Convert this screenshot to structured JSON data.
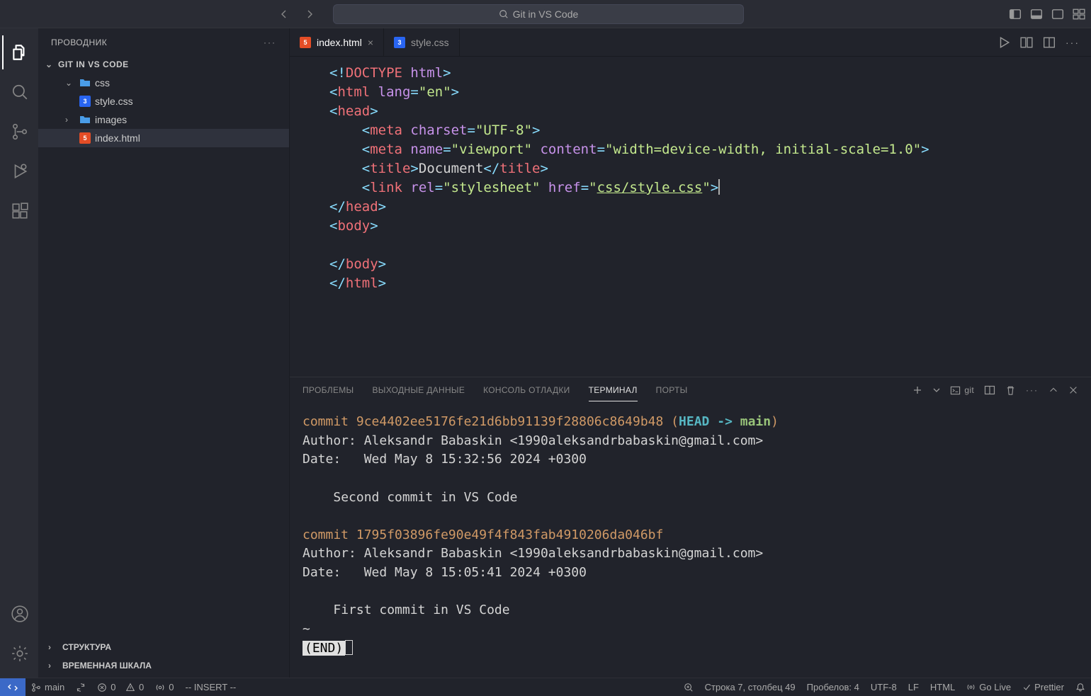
{
  "titlebar": {
    "search_text": "Git in VS Code"
  },
  "sidebar": {
    "title": "ПРОВОДНИК",
    "project": "GIT IN VS CODE",
    "folders": {
      "css": "css",
      "stylecss": "style.css",
      "images": "images",
      "indexhtml": "index.html"
    },
    "structure": "СТРУКТУРА",
    "timeline": "ВРЕМЕННАЯ ШКАЛА"
  },
  "tabs": {
    "index": "index.html",
    "style": "style.css"
  },
  "editor": {
    "l1a": "<!",
    "l1b": "DOCTYPE ",
    "l1c": "html",
    "l1d": ">",
    "l2a": "<",
    "l2b": "html ",
    "l2c": "lang",
    "l2d": "=",
    "l2e": "\"en\"",
    "l2f": ">",
    "l3a": "<",
    "l3b": "head",
    "l3c": ">",
    "l4a": "<",
    "l4b": "meta ",
    "l4c": "charset",
    "l4d": "=",
    "l4e": "\"UTF-8\"",
    "l4f": ">",
    "l5a": "<",
    "l5b": "meta ",
    "l5c": "name",
    "l5d": "=",
    "l5e": "\"viewport\" ",
    "l5f": "content",
    "l5g": "=",
    "l5h": "\"width=device-width, initial-scale=1.0\"",
    "l5i": ">",
    "l6a": "<",
    "l6b": "title",
    "l6c": ">",
    "l6d": "Document",
    "l6e": "</",
    "l6f": "title",
    "l6g": ">",
    "l7a": "<",
    "l7b": "link ",
    "l7c": "rel",
    "l7d": "=",
    "l7e": "\"stylesheet\" ",
    "l7f": "href",
    "l7g": "=",
    "l7h": "\"",
    "l7i": "css/style.css",
    "l7j": "\"",
    "l7k": ">",
    "l8a": "</",
    "l8b": "head",
    "l8c": ">",
    "l9a": "<",
    "l9b": "body",
    "l9c": ">",
    "l10": "",
    "l11a": "</",
    "l11b": "body",
    "l11c": ">",
    "l12a": "</",
    "l12b": "html",
    "l12c": ">"
  },
  "panel": {
    "problems": "ПРОБЛЕМЫ",
    "output": "ВЫХОДНЫЕ ДАННЫЕ",
    "debug": "КОНСОЛЬ ОТЛАДКИ",
    "terminal": "ТЕРМИНАЛ",
    "ports": "ПОРТЫ",
    "git_label": "git"
  },
  "terminal": {
    "c1_commit": "commit ",
    "c1_hash": "9ce4402ee5176fe21d6bb91139f28806c8649b48",
    "c1_open": " (",
    "c1_head": "HEAD",
    "c1_arrow": " -> ",
    "c1_branch": "main",
    "c1_close": ")",
    "c1_author": "Author: Aleksandr Babaskin <1990aleksandrbabaskin@gmail.com>",
    "c1_date": "Date:   Wed May 8 15:32:56 2024 +0300",
    "c1_msg": "    Second commit in VS Code",
    "c2_commit": "commit ",
    "c2_hash": "1795f03896fe90e49f4f843fab4910206da046bf",
    "c2_author": "Author: Aleksandr Babaskin <1990aleksandrbabaskin@gmail.com>",
    "c2_date": "Date:   Wed May 8 15:05:41 2024 +0300",
    "c2_msg": "    First commit in VS Code",
    "tilde": "~",
    "end": "(END)"
  },
  "status": {
    "branch": "main",
    "errors": "0",
    "warnings": "0",
    "port": "0",
    "insert": "-- INSERT --",
    "line_col": "Строка 7, столбец 49",
    "spaces": "Пробелов: 4",
    "encoding": "UTF-8",
    "eol": "LF",
    "lang": "HTML",
    "golive": "Go Live",
    "prettier": "Prettier"
  }
}
